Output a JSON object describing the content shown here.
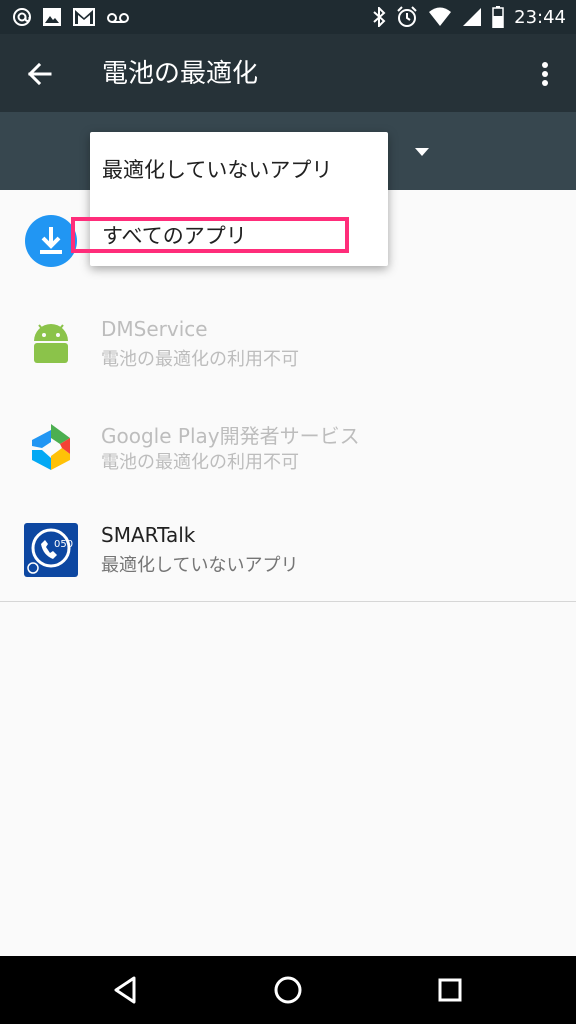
{
  "status_bar": {
    "time": "23:44",
    "left_icons": [
      "at-icon",
      "image-icon",
      "gmail-icon",
      "voicemail-icon"
    ],
    "right_icons": [
      "bluetooth-icon",
      "alarm-icon",
      "wifi-icon",
      "signal-icon",
      "battery-icon"
    ]
  },
  "app_bar": {
    "title": "電池の最適化",
    "back_icon": "arrow-left-icon",
    "menu_icon": "more-vert-icon"
  },
  "dropdown": {
    "options": [
      {
        "label": "最適化していないアプリ"
      },
      {
        "label": "すべてのアプリ"
      }
    ],
    "highlighted_index": 1,
    "highlight_color": "#ff2d7a"
  },
  "apps": [
    {
      "name": "",
      "status": "",
      "icon": "download-icon",
      "disabled": false
    },
    {
      "name": "DMService",
      "status": "電池の最適化の利用不可",
      "icon": "android-icon",
      "disabled": true
    },
    {
      "name": "Google Play開発者サービス",
      "status": "電池の最適化の利用不可",
      "icon": "google-play-services-icon",
      "disabled": true
    },
    {
      "name": "SMARTalk",
      "status": "最適化していないアプリ",
      "icon": "smartalk-icon",
      "disabled": false
    }
  ],
  "nav_bar": {
    "buttons": [
      "back-triangle-icon",
      "home-circle-icon",
      "recents-square-icon"
    ]
  },
  "colors": {
    "status_bar": "#1f2b31",
    "app_bar": "#263238",
    "filter_bar": "#37474f",
    "background": "#fafafa",
    "highlight": "#ff2d7a"
  }
}
